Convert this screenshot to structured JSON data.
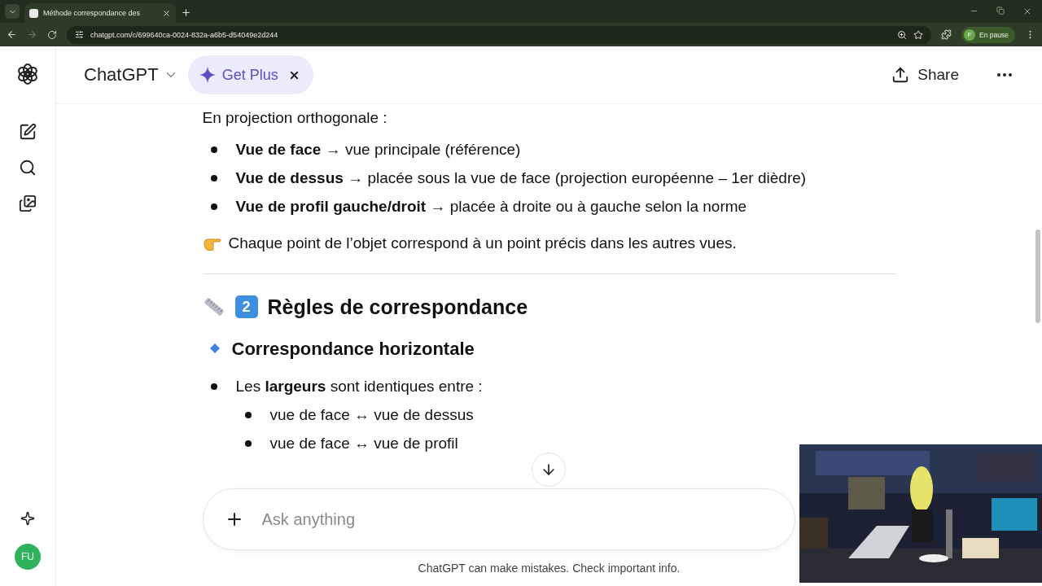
{
  "browser": {
    "tab": {
      "title": "Méthode correspondance des ",
      "selected": true
    },
    "url": "chatgpt.com/c/699640ca-0024-832a-a6b5-d54049e2d244",
    "profile": {
      "initial": "F",
      "status": "En pause"
    }
  },
  "header": {
    "title": "ChatGPT",
    "upgrade": "Get Plus",
    "share": "Share"
  },
  "sidebar": {
    "avatar": "FU"
  },
  "content": [
    {
      "kind": "paragraph",
      "text": "En projection orthogonale :"
    },
    {
      "kind": "list",
      "items": [
        {
          "text": "**Vue de face** → vue principale (référence)"
        },
        {
          "text": "**Vue de dessus** → placée sous la vue de face (projection européenne – 1er dièdre)"
        },
        {
          "text": "**Vue de profil gauche/droit** → placée à droite ou à gauche selon la norme"
        }
      ]
    },
    {
      "kind": "callout",
      "text": "Chaque point de l’objet correspond à un point précis dans les autres vues."
    },
    {
      "kind": "divider"
    },
    {
      "kind": "heading",
      "number": "2",
      "text": "Règles de correspondance"
    },
    {
      "kind": "subheading",
      "text": "Correspondance horizontale"
    },
    {
      "kind": "list",
      "items": [
        {
          "text": "Les **largeurs** sont identiques entre :",
          "children": [
            {
              "text": "vue de face ↔ vue de dessus"
            },
            {
              "text": "vue de face ↔ vue de profil"
            }
          ]
        }
      ]
    }
  ],
  "composer": {
    "placeholder": "Ask anything"
  },
  "footer": "ChatGPT can make mistakes. Check important info."
}
